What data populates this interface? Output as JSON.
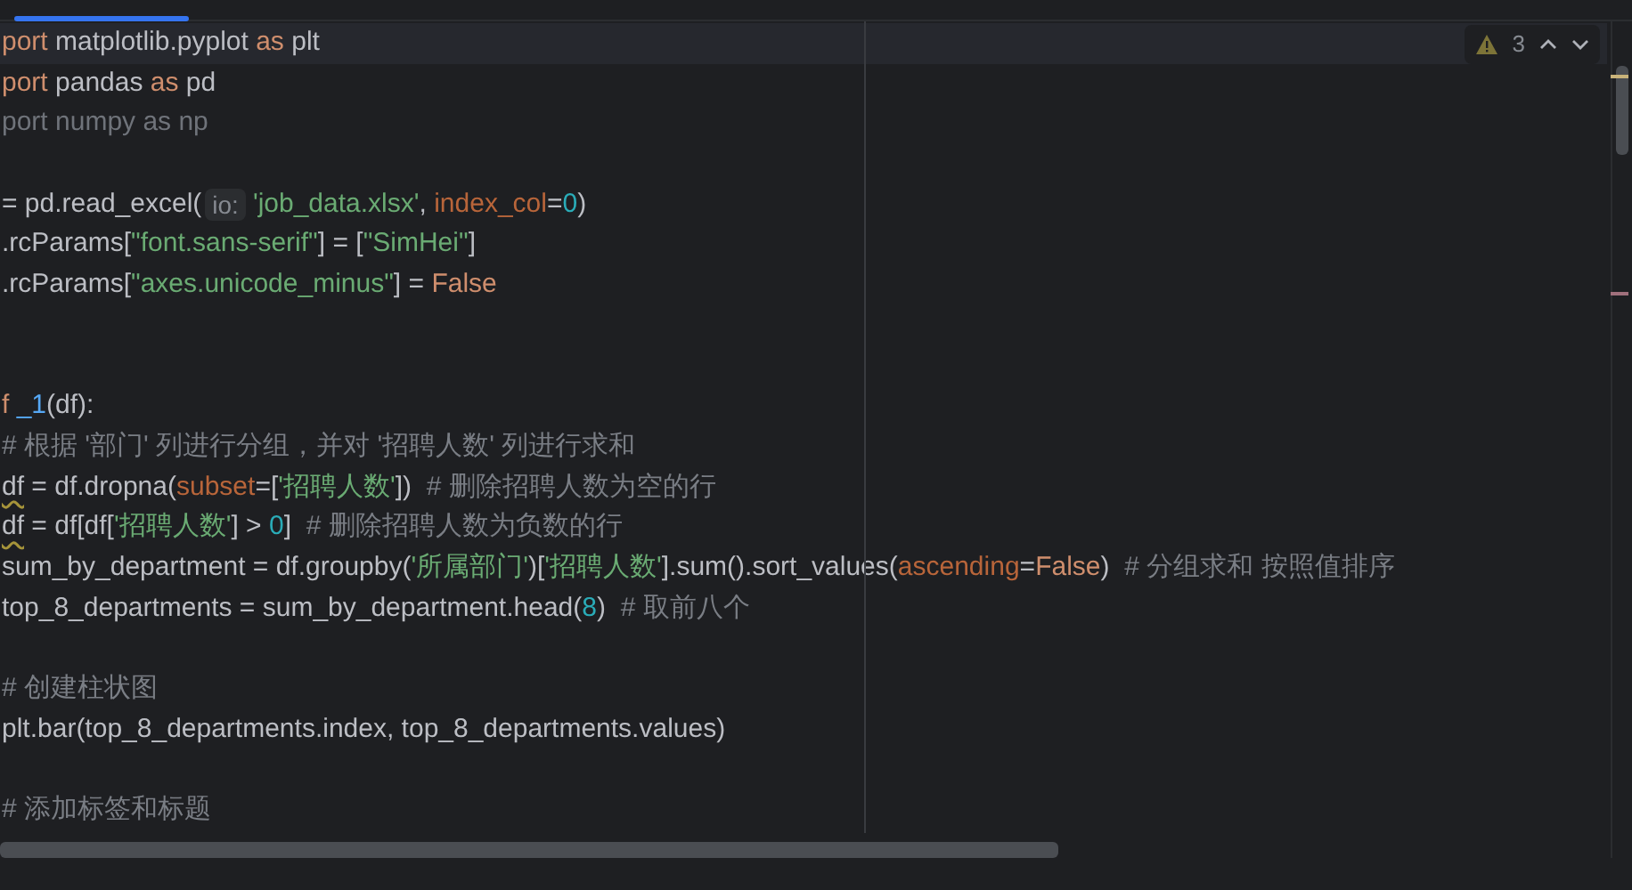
{
  "inspection": {
    "count": "3"
  },
  "blocks": [
    {
      "kind": "start",
      "lines": [
        {
          "current": true,
          "tokens": [
            {
              "kind": "keyword",
              "text": "port"
            },
            {
              "kind": "plain",
              "text": " matplotlib.pyplot "
            },
            {
              "kind": "keyword",
              "text": "as"
            },
            {
              "kind": "plain",
              "text": " plt"
            }
          ]
        },
        {
          "current": false,
          "tokens": [
            {
              "kind": "keyword",
              "text": "port"
            },
            {
              "kind": "plain",
              "text": " pandas "
            },
            {
              "kind": "keyword",
              "text": "as"
            },
            {
              "kind": "plain",
              "text": " pd"
            }
          ]
        },
        {
          "current": false,
          "tokens": [
            {
              "kind": "unused",
              "text": "port numpy as np"
            }
          ]
        }
      ]
    },
    {
      "kind": "after_blank",
      "lines": [
        {
          "current": false,
          "tokens": [
            {
              "kind": "plain",
              "text": "= pd.read_excel("
            },
            {
              "kind": "hint",
              "text": "io:"
            },
            {
              "kind": "string",
              "text": "'job_data.xlsx'"
            },
            {
              "kind": "plain",
              "text": ", "
            },
            {
              "kind": "param",
              "text": "index_col"
            },
            {
              "kind": "plain",
              "text": "="
            },
            {
              "kind": "number",
              "text": "0"
            },
            {
              "kind": "plain",
              "text": ")"
            }
          ]
        },
        {
          "current": false,
          "tokens": [
            {
              "kind": "plain",
              "text": ".rcParams["
            },
            {
              "kind": "string",
              "text": "\"font.sans-serif\""
            },
            {
              "kind": "plain",
              "text": "] = ["
            },
            {
              "kind": "string",
              "text": "\"SimHei\""
            },
            {
              "kind": "plain",
              "text": "]"
            }
          ]
        },
        {
          "current": false,
          "tokens": [
            {
              "kind": "plain",
              "text": ".rcParams["
            },
            {
              "kind": "string",
              "text": "\"axes.unicode_minus\""
            },
            {
              "kind": "plain",
              "text": "] = "
            },
            {
              "kind": "keyword",
              "text": "False"
            }
          ]
        }
      ]
    },
    {
      "kind": "after_two_blanks",
      "lines": [
        {
          "current": false,
          "tokens": [
            {
              "kind": "keyword",
              "text": "f "
            },
            {
              "kind": "function",
              "text": "_1"
            },
            {
              "kind": "plain",
              "text": "(df):"
            }
          ]
        },
        {
          "current": false,
          "tokens": [
            {
              "kind": "comment",
              "text": "# 根据 '部门' 列进行分组，并对 '招聘人数' 列进行求和"
            }
          ]
        },
        {
          "current": false,
          "tokens": [
            {
              "kind": "warned",
              "text": "df"
            },
            {
              "kind": "plain",
              "text": " = df.dropna("
            },
            {
              "kind": "param",
              "text": "subset"
            },
            {
              "kind": "plain",
              "text": "=["
            },
            {
              "kind": "string",
              "text": "'招聘人数'"
            },
            {
              "kind": "plain",
              "text": "])  "
            },
            {
              "kind": "comment",
              "text": "# 删除招聘人数为空的行"
            }
          ]
        },
        {
          "current": false,
          "tokens": [
            {
              "kind": "warned",
              "text": "df"
            },
            {
              "kind": "plain",
              "text": " = df[df["
            },
            {
              "kind": "string",
              "text": "'招聘人数'"
            },
            {
              "kind": "plain",
              "text": "] > "
            },
            {
              "kind": "number",
              "text": "0"
            },
            {
              "kind": "plain",
              "text": "]  "
            },
            {
              "kind": "comment",
              "text": "# 删除招聘人数为负数的行"
            }
          ]
        },
        {
          "current": false,
          "tokens": [
            {
              "kind": "plain",
              "text": "sum_by_department = df.groupby("
            },
            {
              "kind": "string",
              "text": "'所属部门'"
            },
            {
              "kind": "plain",
              "text": ")["
            },
            {
              "kind": "string",
              "text": "'招聘人数'"
            },
            {
              "kind": "plain",
              "text": "].sum().sort_values("
            },
            {
              "kind": "param",
              "text": "ascending"
            },
            {
              "kind": "plain",
              "text": "="
            },
            {
              "kind": "keyword",
              "text": "False"
            },
            {
              "kind": "plain",
              "text": ")  "
            },
            {
              "kind": "comment",
              "text": "# 分组求和 按照值排序"
            }
          ]
        },
        {
          "current": false,
          "tokens": [
            {
              "kind": "plain",
              "text": "top_8_departments = sum_by_department.head("
            },
            {
              "kind": "number",
              "text": "8"
            },
            {
              "kind": "plain",
              "text": ")  "
            },
            {
              "kind": "comment",
              "text": "# 取前八个"
            }
          ]
        }
      ]
    },
    {
      "kind": "after_blank",
      "lines": [
        {
          "current": false,
          "tokens": [
            {
              "kind": "comment",
              "text": "# 创建柱状图"
            }
          ]
        },
        {
          "current": false,
          "tokens": [
            {
              "kind": "plain",
              "text": "plt.bar(top_8_departments.index, top_8_departments.values)"
            }
          ]
        }
      ]
    },
    {
      "kind": "after_blank",
      "lines": [
        {
          "current": false,
          "tokens": [
            {
              "kind": "comment",
              "text": "# 添加标签和标题"
            }
          ]
        }
      ]
    }
  ]
}
